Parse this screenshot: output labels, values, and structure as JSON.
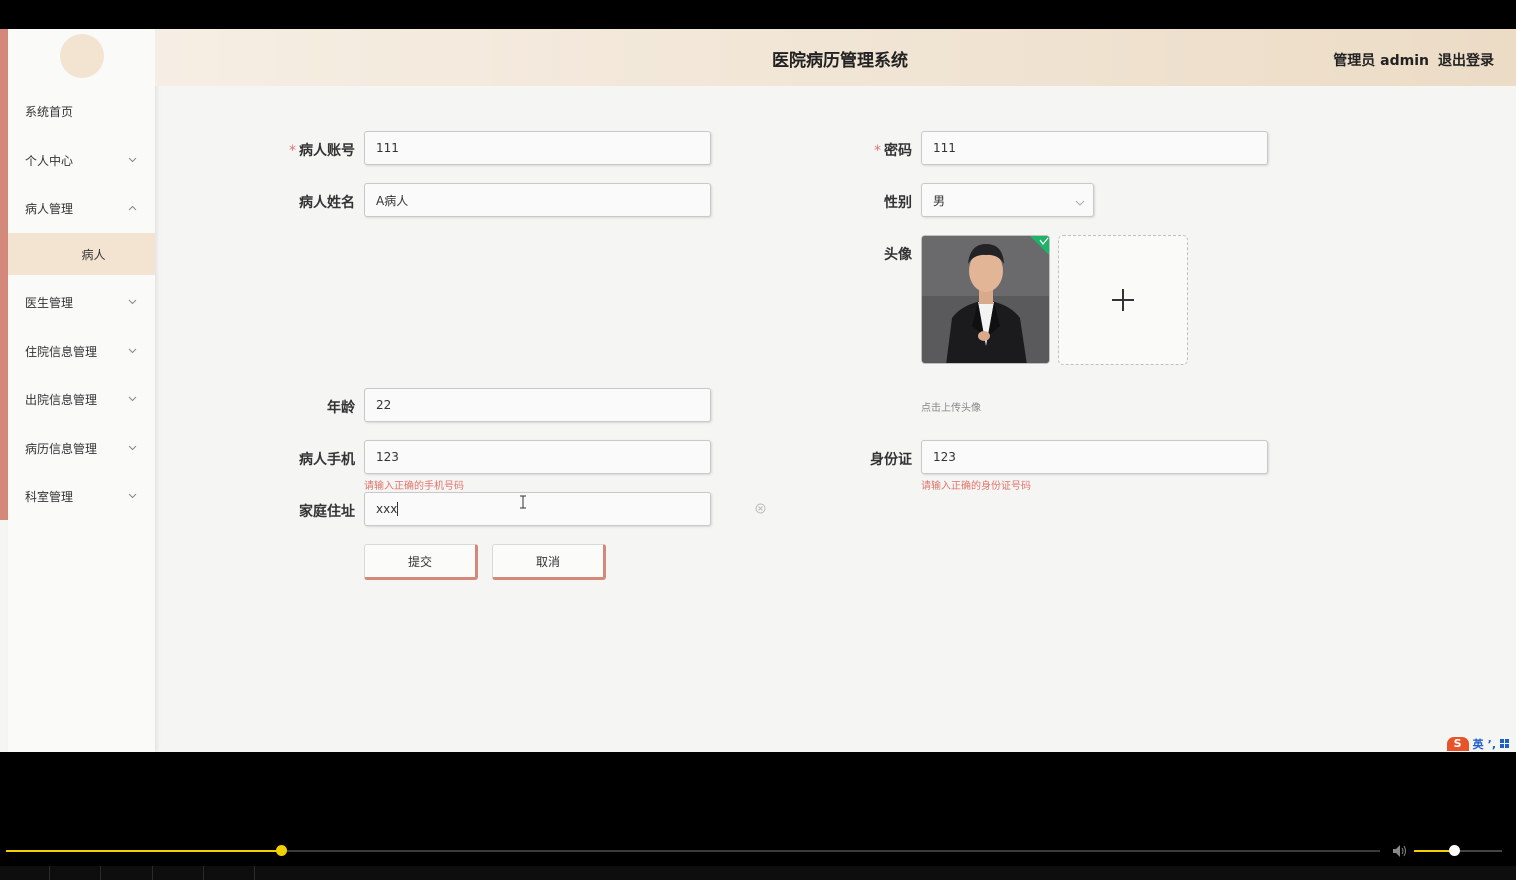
{
  "header": {
    "title": "医院病历管理系统",
    "user": "管理员 admin",
    "logout": "退出登录"
  },
  "sidebar": {
    "items": [
      {
        "label": "系统首页",
        "chevron": "none"
      },
      {
        "label": "个人中心",
        "chevron": "down"
      },
      {
        "label": "病人管理",
        "chevron": "up"
      },
      {
        "label": "医生管理",
        "chevron": "down"
      },
      {
        "label": "住院信息管理",
        "chevron": "down"
      },
      {
        "label": "出院信息管理",
        "chevron": "down"
      },
      {
        "label": "病历信息管理",
        "chevron": "down"
      },
      {
        "label": "科室管理",
        "chevron": "down"
      }
    ],
    "active_sub": "病人"
  },
  "form": {
    "account": {
      "label": "病人账号",
      "value": "111",
      "required": true
    },
    "password": {
      "label": "密码",
      "value": "111",
      "required": true
    },
    "name": {
      "label": "病人姓名",
      "value": "A病人"
    },
    "gender": {
      "label": "性别",
      "value": "男"
    },
    "avatar": {
      "label": "头像",
      "hint": "点击上传头像"
    },
    "age": {
      "label": "年龄",
      "value": "22"
    },
    "phone": {
      "label": "病人手机",
      "value": "123",
      "error": "请输入正确的手机号码"
    },
    "idcard": {
      "label": "身份证",
      "value": "123",
      "error": "请输入正确的身份证号码"
    },
    "address": {
      "label": "家庭住址",
      "value": "xxx"
    },
    "submit": "提交",
    "cancel": "取消"
  },
  "ime": {
    "logo": "S",
    "lang": "英",
    "punct": "’,"
  },
  "player": {
    "progress": 0.2,
    "volume": 0.45
  },
  "colors": {
    "accent": "#d4887a",
    "header_bg": "#ecdcc6",
    "error": "#e0756b",
    "progress": "#f2d000"
  }
}
